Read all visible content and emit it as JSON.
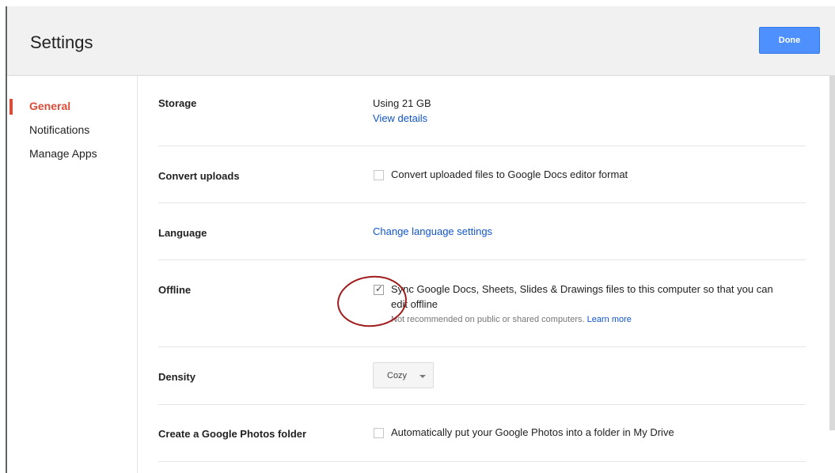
{
  "header": {
    "title": "Settings",
    "done_label": "Done"
  },
  "sidebar": {
    "items": [
      {
        "label": "General",
        "active": true
      },
      {
        "label": "Notifications",
        "active": false
      },
      {
        "label": "Manage Apps",
        "active": false
      }
    ]
  },
  "settings": {
    "storage": {
      "label": "Storage",
      "value": "Using 21 GB",
      "link": "View details"
    },
    "convert_uploads": {
      "label": "Convert uploads",
      "checked": false,
      "text": "Convert uploaded files to Google Docs editor format"
    },
    "language": {
      "label": "Language",
      "link": "Change language settings"
    },
    "offline": {
      "label": "Offline",
      "checked": true,
      "text_line1": "Sync Google Docs, Sheets, Slides & Drawings files to this computer so that you can",
      "text_line2": "edit offline",
      "note": "Not recommended on public or shared computers.",
      "note_link": "Learn more"
    },
    "density": {
      "label": "Density",
      "value": "Cozy"
    },
    "photos_folder": {
      "label": "Create a Google Photos folder",
      "checked": false,
      "text": "Automatically put your Google Photos into a folder in My Drive"
    }
  },
  "colors": {
    "accent_red": "#dd4b39",
    "button_blue": "#4d90fe",
    "link_blue": "#1155cc",
    "annotation_red": "#a01c1c"
  }
}
